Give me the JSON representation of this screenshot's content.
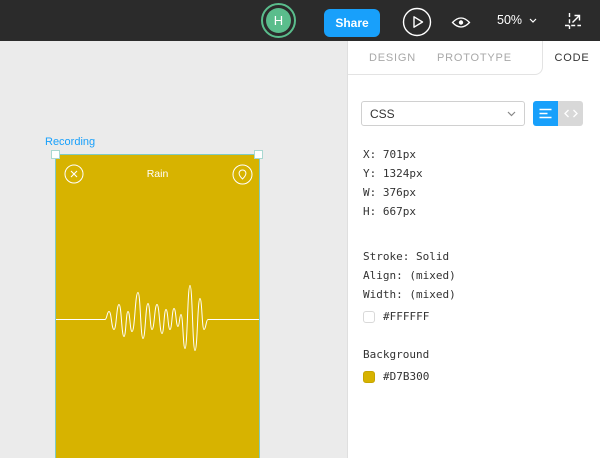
{
  "toolbar": {
    "avatar_initial": "H",
    "share_label": "Share",
    "zoom_level": "50%"
  },
  "tabs": [
    "DESIGN",
    "PROTOTYPE",
    "CODE"
  ],
  "code_panel": {
    "language_select_value": "CSS",
    "position_lines": [
      "X: 701px",
      "Y: 1324px",
      "W: 376px",
      "H: 667px"
    ],
    "stroke_lines": [
      "Stroke: Solid",
      "Align: (mixed)",
      "Width: (mixed)"
    ],
    "stroke_color_hex": "#FFFFFF",
    "background_label": "Background",
    "background_color_hex": "#D7B300"
  },
  "canvas": {
    "frame_label": "Recording",
    "artboard_title": "Rain"
  },
  "colors": {
    "accent_blue": "#18A0FB",
    "artboard_yellow": "#D7B300",
    "avatar_green": "#5ABD8C",
    "selection_teal": "#7FCBC4",
    "toolbar_dark": "#2B2B2B"
  }
}
